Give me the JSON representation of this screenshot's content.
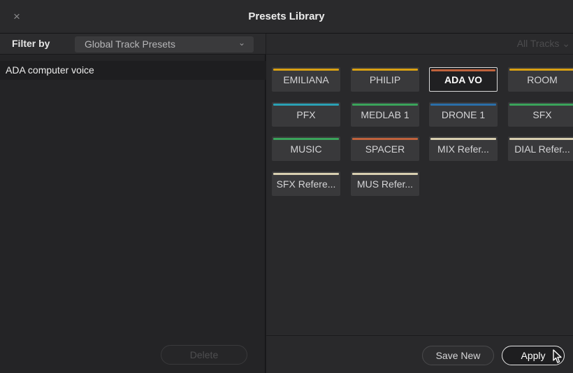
{
  "window": {
    "title": "Presets Library",
    "close_glyph": "×"
  },
  "filter": {
    "label": "Filter by",
    "selected": "Global Track Presets"
  },
  "presets": [
    {
      "label": "ADA computer voice"
    }
  ],
  "left_actions": {
    "delete_label": "Delete"
  },
  "tracks_filter": {
    "selected": "All Tracks"
  },
  "chips": [
    {
      "label": "EMILIANA",
      "color": "#d8a012"
    },
    {
      "label": "PHILIP",
      "color": "#d8a012"
    },
    {
      "label": "ADA VO",
      "color": "#c0623c",
      "selected": true
    },
    {
      "label": "ROOM",
      "color": "#d8a012"
    },
    {
      "label": "PFX",
      "color": "#2aa0b4"
    },
    {
      "label": "MEDLAB 1",
      "color": "#3aa35a"
    },
    {
      "label": "DRONE 1",
      "color": "#2a6ea8"
    },
    {
      "label": "SFX",
      "color": "#3aa35a"
    },
    {
      "label": "MUSIC",
      "color": "#3aa35a"
    },
    {
      "label": "SPACER",
      "color": "#c0623c"
    },
    {
      "label": "MIX Refer...",
      "color": "#d8cfb0"
    },
    {
      "label": "DIAL Refer...",
      "color": "#d8cfb0"
    },
    {
      "label": "SFX Refere...",
      "color": "#d8cfb0"
    },
    {
      "label": "MUS Refer...",
      "color": "#d8cfb0"
    }
  ],
  "actions": {
    "save_new": "Save New",
    "apply": "Apply"
  }
}
